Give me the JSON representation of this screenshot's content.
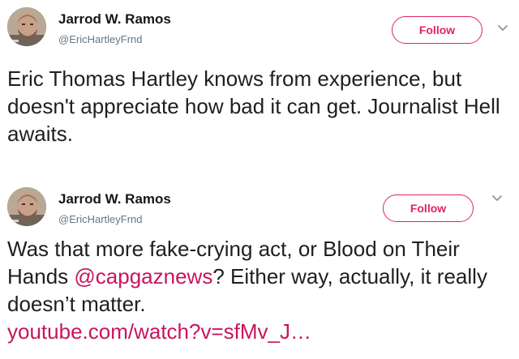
{
  "tweets": [
    {
      "author_name": "Jarrod W. Ramos",
      "author_handle": "@EricHartleyFrnd",
      "follow_label": "Follow",
      "text": "Eric Thomas Hartley knows from experience, but doesn't appreciate how bad it can get. Journalist Hell awaits."
    },
    {
      "author_name": "Jarrod W. Ramos",
      "author_handle": "@EricHartleyFrnd",
      "follow_label": "Follow",
      "text_before_mention": "Was that more fake-crying act, or Blood on Their Hands ",
      "mention": "@capgaznews",
      "text_after_mention": "? Either way, actually, it really doesn’t matter.",
      "link": "youtube.com/watch?v=sfMv_J…"
    }
  ],
  "icons": {
    "avatar": "avatar",
    "more_menu": "chevron-down-icon"
  },
  "colors": {
    "follow_accent": "#e0245e",
    "link": "#c8155d",
    "secondary_text": "#657786",
    "primary_text": "#1c2022"
  }
}
